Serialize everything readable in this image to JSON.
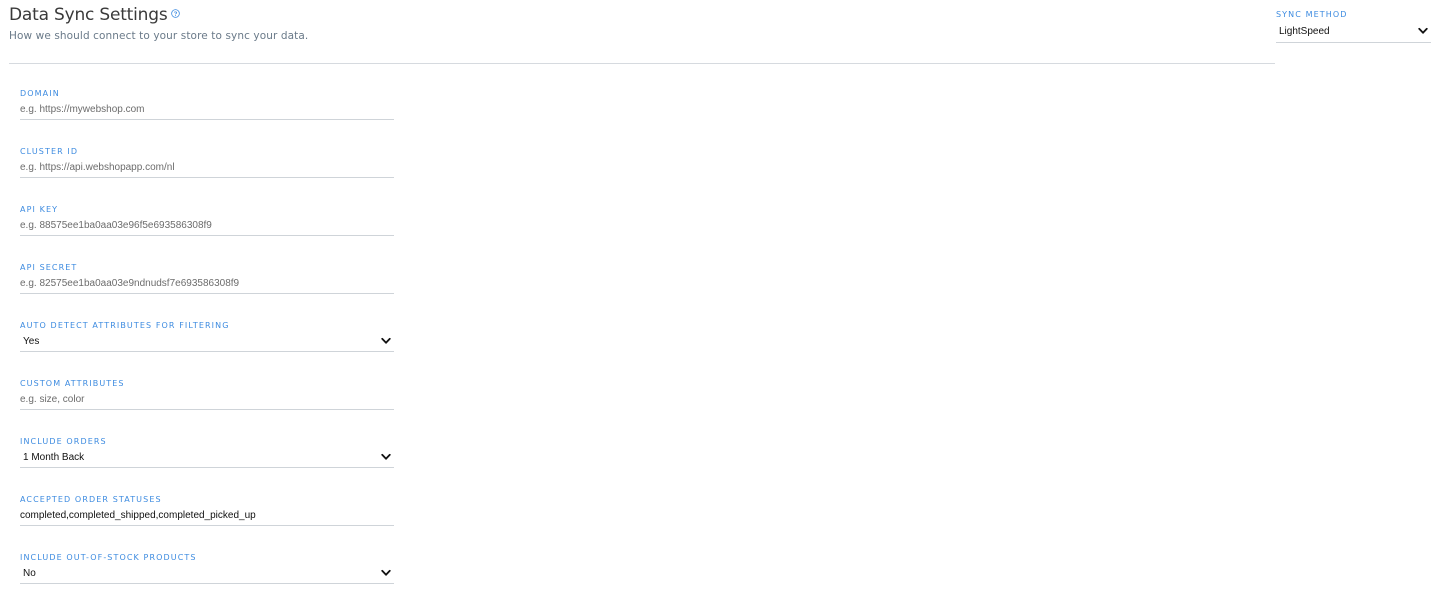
{
  "header": {
    "title": "Data Sync Settings",
    "subtitle": "How we should connect to your store to sync your data.",
    "help_icon": "question-circle-icon"
  },
  "sync_method": {
    "label": "SYNC METHOD",
    "value": "LightSpeed"
  },
  "form": {
    "domain": {
      "label": "DOMAIN",
      "value": "",
      "placeholder": "e.g. https://mywebshop.com"
    },
    "cluster_id": {
      "label": "CLUSTER ID",
      "value": "",
      "placeholder": "e.g. https://api.webshopapp.com/nl"
    },
    "api_key": {
      "label": "API KEY",
      "value": "",
      "placeholder": "e.g. 88575ee1ba0aa03e96f5e693586308f9"
    },
    "api_secret": {
      "label": "API SECRET",
      "value": "",
      "placeholder": "e.g. 82575ee1ba0aa03e9ndnudsf7e693586308f9"
    },
    "auto_detect": {
      "label": "AUTO DETECT ATTRIBUTES FOR FILTERING",
      "value": "Yes"
    },
    "custom_attributes": {
      "label": "CUSTOM ATTRIBUTES",
      "value": "",
      "placeholder": "e.g. size, color"
    },
    "include_orders": {
      "label": "INCLUDE ORDERS",
      "value": "1 Month Back"
    },
    "accepted_statuses": {
      "label": "ACCEPTED ORDER STATUSES",
      "value": "completed,completed_shipped,completed_picked_up",
      "placeholder": ""
    },
    "include_oos": {
      "label": "INCLUDE OUT-OF-STOCK PRODUCTS",
      "value": "No"
    }
  },
  "colors": {
    "label_accent": "#3d8be0",
    "divider": "#d6dadf",
    "title": "#3a3a3a",
    "subtitle": "#6a7a89"
  },
  "icons": {
    "dropdown": "chevron-down-icon"
  }
}
